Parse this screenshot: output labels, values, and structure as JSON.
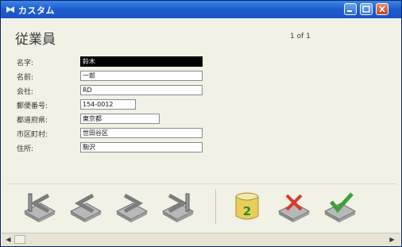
{
  "window": {
    "title": "カスタム"
  },
  "header": {
    "layout_title": "従業員",
    "record_count": "1 of 1"
  },
  "form": {
    "fields": [
      {
        "label": "名字:",
        "value": "鈴木",
        "active": true
      },
      {
        "label": "名前:",
        "value": "一郎",
        "active": false
      },
      {
        "label": "会社:",
        "value": "RD",
        "active": false
      },
      {
        "label": "郵便番号:",
        "value": "154-0012",
        "active": false
      },
      {
        "label": "都道府県:",
        "value": "東京都",
        "active": false
      },
      {
        "label": "市区町村:",
        "value": "世田谷区",
        "active": false
      },
      {
        "label": "住所:",
        "value": "駒沢",
        "active": false
      }
    ]
  },
  "toolbar": {
    "buttons": [
      {
        "name": "first-record-icon"
      },
      {
        "name": "previous-record-icon"
      },
      {
        "name": "next-record-icon"
      },
      {
        "name": "last-record-icon"
      },
      {
        "name": "new-record-icon"
      },
      {
        "name": "delete-record-icon"
      },
      {
        "name": "confirm-record-icon"
      }
    ]
  },
  "colors": {
    "titlebar": "#1f5fd0",
    "active_field": "#000000",
    "window_bg": "#f2f1e6"
  }
}
